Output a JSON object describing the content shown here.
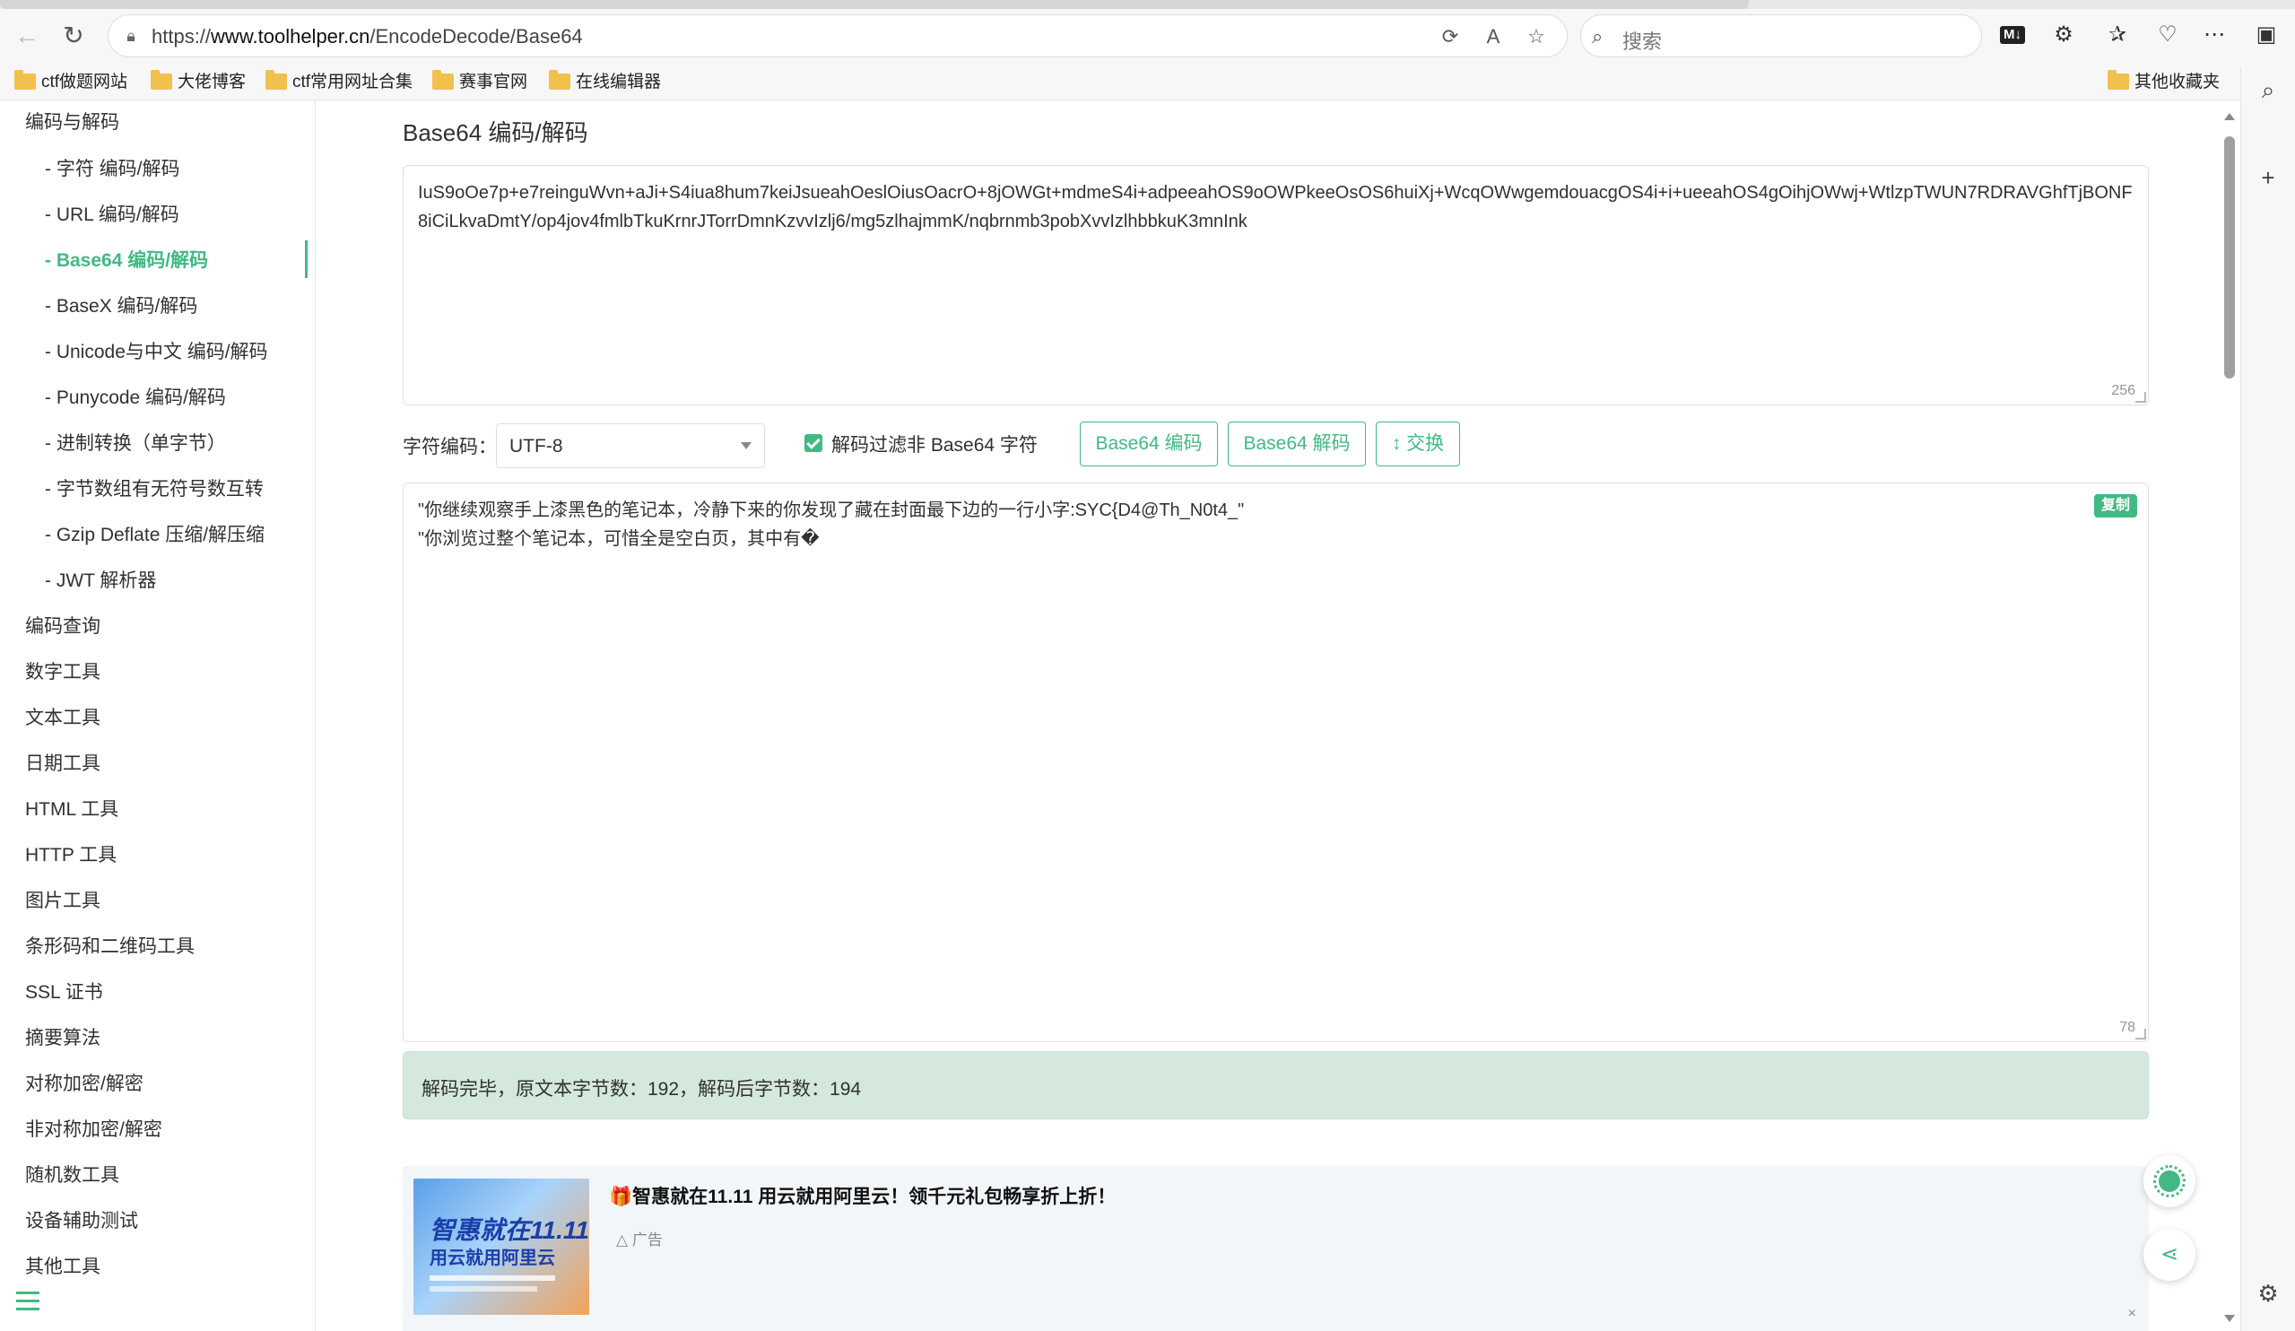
{
  "browser": {
    "url_prefix": "https://",
    "url_host": "www.toolhelper.cn",
    "url_path": "/EncodeDecode/Base64",
    "search_placeholder": "搜索",
    "md_badge": "M↓"
  },
  "bookmarks": [
    {
      "label": "ctf做题网站"
    },
    {
      "label": "大佬博客"
    },
    {
      "label": "ctf常用网址合集"
    },
    {
      "label": "赛事官网"
    },
    {
      "label": "在线编辑器"
    }
  ],
  "bookmarks_other": "其他收藏夹",
  "sidebar": {
    "section": "编码与解码",
    "sub_items": [
      {
        "label": "- 字符  编码/解码"
      },
      {
        "label": "- URL  编码/解码"
      },
      {
        "label": "- Base64  编码/解码"
      },
      {
        "label": "- BaseX  编码/解码"
      },
      {
        "label": "- Unicode与中文  编码/解码"
      },
      {
        "label": "- Punycode  编码/解码"
      },
      {
        "label": "- 进制转换（单字节）"
      },
      {
        "label": "- 字节数组有无符号数互转"
      },
      {
        "label": "- Gzip Deflate 压缩/解压缩"
      },
      {
        "label": "- JWT 解析器"
      }
    ],
    "items": [
      {
        "label": "编码查询"
      },
      {
        "label": "数字工具"
      },
      {
        "label": "文本工具"
      },
      {
        "label": "日期工具"
      },
      {
        "label": "HTML 工具"
      },
      {
        "label": "HTTP 工具"
      },
      {
        "label": "图片工具"
      },
      {
        "label": "条形码和二维码工具"
      },
      {
        "label": "SSL 证书"
      },
      {
        "label": "摘要算法"
      },
      {
        "label": "对称加密/解密"
      },
      {
        "label": "非对称加密/解密"
      },
      {
        "label": "随机数工具"
      },
      {
        "label": "设备辅助测试"
      },
      {
        "label": "其他工具"
      }
    ]
  },
  "main": {
    "title": "Base64 编码/解码",
    "input_text": "IuS9oOe7p+e7reinguWvn+aJi+S4iua8hum7keiJsueahOeslOiusOacrO+8jOWGt+mdmeS4i+adpeeahOS9oOWPkeeOsOS6huiXj+WcqOWwgemdouacgOS4i+i+ueeahOS4gOihjOWwj+WtlzpTWUN7RDRAVGhfTjBONF8iCiLkvaDmtY/op4jov4fmlbTkuKrnrJTorrDmnKzvvIzlj6/mg5zlhajmmK/nqbrnmb3pobXvvIzlhbbkuK3mnInk",
    "input_count": "256",
    "charset_label": "字符编码：",
    "charset_value": "UTF-8",
    "filter_label": "解码过滤非 Base64 字符",
    "btn_encode": "Base64 编码",
    "btn_decode": "Base64 解码",
    "btn_swap": "↕ 交换",
    "output_line1": "\"你继续观察手上漆黑色的笔记本，冷静下来的你发现了藏在封面最下边的一行小字:SYC{D4@Th_N0t4_\"",
    "output_line2": "\"你浏览过整个笔记本，可惜全是空白页，其中有�",
    "output_count": "78",
    "copy_label": "复制",
    "status": "解码完毕，原文本字节数：192，解码后字节数：194"
  },
  "ad": {
    "title": "🎁智惠就在11.11 用云就用阿里云！领千元礼包畅享折上折！",
    "tag": "广告",
    "close": "×",
    "img_big": "智惠就在11.11",
    "img_sub": "用云就用阿里云"
  },
  "colors": {
    "accent": "#42b983",
    "alert_bg": "#d4e8dd"
  }
}
